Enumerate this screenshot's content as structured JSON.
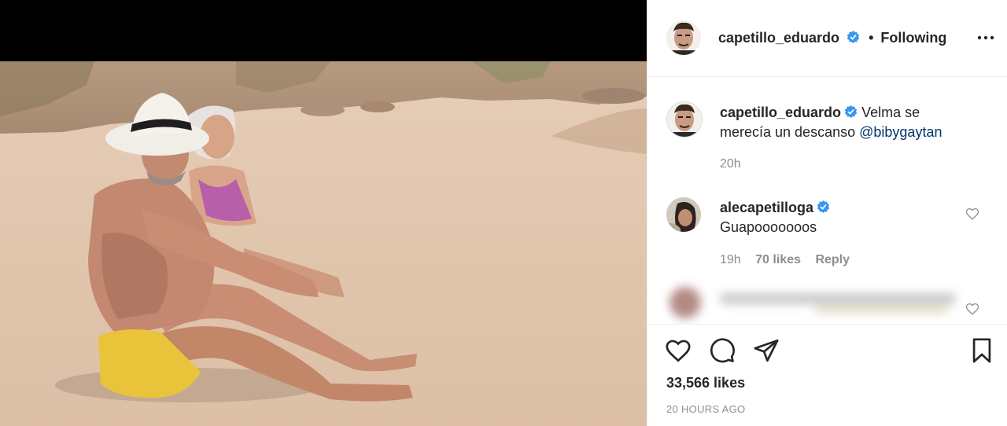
{
  "post": {
    "author": "capetillo_eduardo",
    "follow_status": "Following",
    "dot": "•",
    "caption_text": "Velma se merecía un descanso",
    "caption_mention": "@bibygaytan",
    "caption_time": "20h",
    "likes": "33,566 likes",
    "posted_ago": "20 HOURS AGO"
  },
  "comments": [
    {
      "user": "alecapetilloga",
      "text": "Guapooooooos",
      "time": "19h",
      "likes": "70 likes",
      "reply": "Reply"
    }
  ],
  "icons": {
    "verified": "verified-badge-icon",
    "more": "more-options-icon",
    "like": "heart-icon",
    "comment": "comment-icon",
    "share": "share-icon",
    "save": "bookmark-icon"
  },
  "colors": {
    "verified": "#3897f0",
    "muted": "#8e8e8e",
    "mention": "#00376b",
    "text": "#262626"
  }
}
